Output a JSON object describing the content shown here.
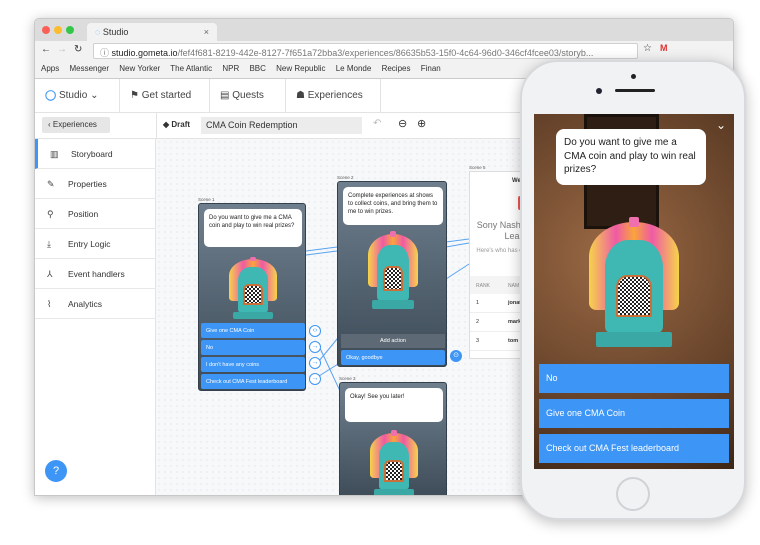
{
  "browser": {
    "tab_title": "Studio",
    "url_host": "studio.gometa.io",
    "url_path": "/fef4f681-8219-442e-8127-7f651a72bba3/experiences/86635b53-15f0-4c64-96d0-346cf4fcee03/storyb...",
    "bookmarks": [
      "Apps",
      "Messenger",
      "New Yorker",
      "The Atlantic",
      "NPR",
      "BBC",
      "New Republic",
      "Le Monde",
      "Recipes",
      "Finan"
    ]
  },
  "header": {
    "app": "Studio",
    "nav": [
      "Get started",
      "Quests",
      "Experiences"
    ]
  },
  "toolbar": {
    "back": "Experiences",
    "status": "Draft",
    "title": "CMA Coin Redemption"
  },
  "sidebar": {
    "items": [
      "Storyboard",
      "Properties",
      "Position",
      "Entry Logic",
      "Event handlers",
      "Analytics"
    ],
    "help": "?"
  },
  "scenes": {
    "scene1": {
      "label": "Scene 1",
      "text": "Do you want to give me a CMA coin and play to win real prizes?",
      "actions": [
        "Give one CMA Coin",
        "No",
        "I don't have any coins",
        "Check out CMA Fest leaderboard"
      ]
    },
    "scene2": {
      "label": "Scene 2",
      "text": "Complete experiences at shows to collect coins, and bring them to me to win prizes.",
      "add_action": "Add action",
      "actions": [
        "Okay, goodbye"
      ]
    },
    "scene3": {
      "label": "Scene 3",
      "text": "Okay! See you later!"
    },
    "scene5": {
      "label": "Scene 5",
      "header": "We",
      "title": "Sony Nashvi Fest Lea",
      "subtitle": "Here's who has experiences",
      "columns": [
        "RANK",
        "NAM"
      ],
      "rows": [
        [
          "1",
          "jonat"
        ],
        [
          "2",
          "mark"
        ],
        [
          "3",
          "tom"
        ]
      ]
    }
  },
  "phone": {
    "text": "Do you want to give me a CMA coin and play to win real prizes?",
    "buttons": [
      "No",
      "Give one CMA Coin",
      "Check out CMA Fest leaderboard"
    ]
  },
  "colors": {
    "accent": "#3d95f5"
  }
}
